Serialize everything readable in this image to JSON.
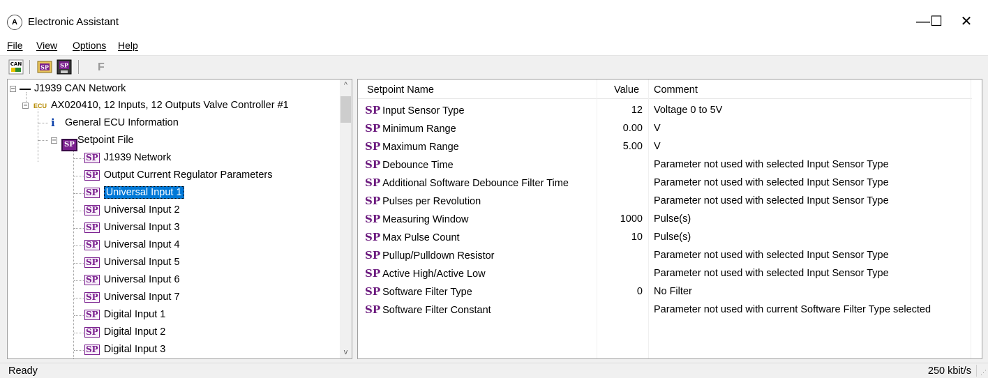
{
  "window": {
    "title": "Electronic Assistant",
    "icon_text": "A",
    "minimize_glyph": "—",
    "maximize_glyph": "☐",
    "close_glyph": "✕"
  },
  "menu": [
    {
      "label": "File"
    },
    {
      "label": "View"
    },
    {
      "label": "Options"
    },
    {
      "label": "Help"
    }
  ],
  "toolbar": {
    "can_label": "CAN",
    "sp_label": "SP",
    "f_label": "F"
  },
  "tree": {
    "root": "J1939 CAN Network",
    "ecu_prefix": "ECU",
    "ecu": "AX020410, 12 Inputs, 12 Outputs Valve Controller #1",
    "info_icon": "i",
    "info": "General ECU Information",
    "setpoint_file": "Setpoint File",
    "items": [
      {
        "label": "J1939 Network"
      },
      {
        "label": "Output Current Regulator Parameters"
      },
      {
        "label": "Universal Input 1"
      },
      {
        "label": "Universal Input 2"
      },
      {
        "label": "Universal Input 3"
      },
      {
        "label": "Universal Input 4"
      },
      {
        "label": "Universal Input 5"
      },
      {
        "label": "Universal Input 6"
      },
      {
        "label": "Universal Input 7"
      },
      {
        "label": "Digital Input 1"
      },
      {
        "label": "Digital Input 2"
      },
      {
        "label": "Digital Input 3"
      }
    ],
    "selected_index": 2,
    "sp_badge": "SP",
    "scroll_up": "^",
    "scroll_down": "v"
  },
  "grid": {
    "headers": {
      "name": "Setpoint Name",
      "value": "Value",
      "comment": "Comment"
    },
    "sp_prefix": "SP",
    "rows": [
      {
        "name": "Input Sensor Type",
        "value": "12",
        "comment": "Voltage 0 to 5V"
      },
      {
        "name": "Minimum Range",
        "value": "0.00",
        "comment": "V"
      },
      {
        "name": "Maximum Range",
        "value": "5.00",
        "comment": "V"
      },
      {
        "name": "Debounce Time",
        "value": "",
        "comment": "Parameter not used with selected Input Sensor Type"
      },
      {
        "name": "Additional Software Debounce Filter Time",
        "value": "",
        "comment": "Parameter not used with selected Input Sensor Type"
      },
      {
        "name": "Pulses per Revolution",
        "value": "",
        "comment": "Parameter not used with selected Input Sensor Type"
      },
      {
        "name": "Measuring Window",
        "value": "1000",
        "comment": "Pulse(s)"
      },
      {
        "name": "Max Pulse Count",
        "value": "10",
        "comment": "Pulse(s)"
      },
      {
        "name": "Pullup/Pulldown Resistor",
        "value": "",
        "comment": "Parameter not used with selected Input Sensor Type"
      },
      {
        "name": "Active High/Active Low",
        "value": "",
        "comment": "Parameter not used with selected Input Sensor Type"
      },
      {
        "name": "Software Filter Type",
        "value": "0",
        "comment": "No Filter"
      },
      {
        "name": "Software Filter Constant",
        "value": "",
        "comment": "Parameter not used with current Software Filter Type selected"
      }
    ]
  },
  "status": {
    "left": "Ready",
    "right": "250 kbit/s"
  },
  "colors": {
    "accent": "#0078d7",
    "sp_purple": "#7a1f8e"
  }
}
